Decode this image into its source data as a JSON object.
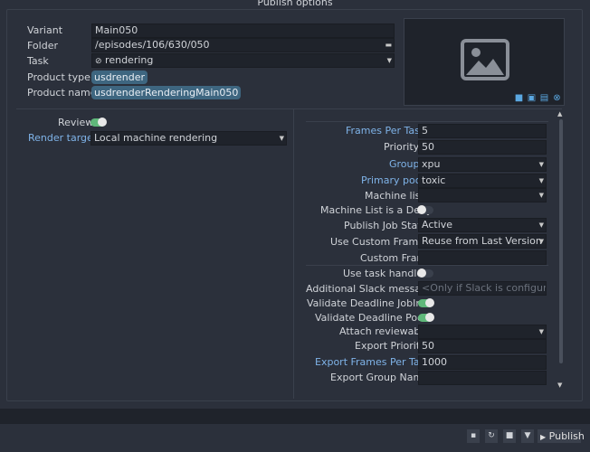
{
  "window": {
    "title": "Publish options"
  },
  "context": {
    "variant": {
      "label": "Variant",
      "value": "Main050"
    },
    "folder": {
      "label": "Folder",
      "value": "/episodes/106/630/050"
    },
    "task": {
      "label": "Task",
      "value": "rendering",
      "icon": "check-circle-icon"
    },
    "product_type": {
      "label": "Product type",
      "value": "usdrender"
    },
    "product_name": {
      "label": "Product name",
      "value": "usdrenderRenderingMain050"
    }
  },
  "thumbnail": {
    "icons": [
      "camera-icon",
      "paste-icon",
      "folder-icon",
      "close-icon"
    ]
  },
  "left_options": {
    "review": {
      "label": "Review",
      "on": true
    },
    "render_target": {
      "label": "Render target",
      "value": "Local machine rendering"
    }
  },
  "deadline": {
    "frames_per_task": {
      "label": "Frames Per Task",
      "value": "5"
    },
    "priority": {
      "label": "Priority",
      "value": "50"
    },
    "group": {
      "label": "Group",
      "value": "xpu"
    },
    "primary_pool": {
      "label": "Primary pool",
      "value": "toxic"
    },
    "machine_list": {
      "label": "Machine list",
      "value": ""
    },
    "machine_list_deny": {
      "label": "Machine List is a Deny",
      "on": false
    },
    "publish_job_state": {
      "label": "Publish Job State",
      "value": "Active"
    },
    "use_custom_frames": {
      "label": "Use Custom Frames",
      "value": "Reuse from Last Version"
    },
    "custom_frames": {
      "label": "Custom Frames",
      "value": ""
    },
    "use_task_handles": {
      "label": "Use task handles",
      "on": false
    },
    "additional_slack": {
      "label": "Additional Slack message",
      "placeholder": "<Only if Slack is configured>"
    },
    "validate_jobinfo": {
      "label": "Validate Deadline JobInfo",
      "on": true
    },
    "validate_pools": {
      "label": "Validate Deadline Pools",
      "on": true
    },
    "attach_reviewable": {
      "label": "Attach reviewable",
      "value": ""
    },
    "export_priority": {
      "label": "Export Priority",
      "value": "50"
    },
    "export_frames_per_task": {
      "label": "Export Frames Per Task",
      "value": "1000"
    },
    "export_group_name": {
      "label": "Export Group Name",
      "value": ""
    }
  },
  "footer": {
    "publish_label": "Publish",
    "buttons": [
      "save-icon",
      "refresh-icon",
      "stop-icon",
      "validate-icon"
    ]
  }
}
